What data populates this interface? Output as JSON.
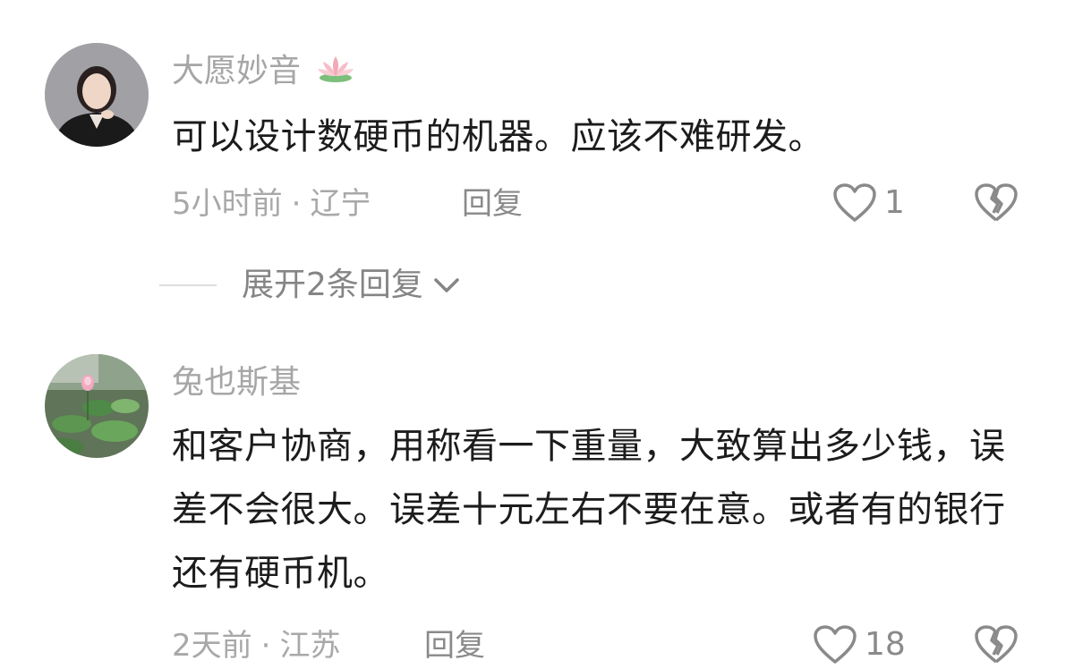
{
  "comments": [
    {
      "username": "大愿妙音",
      "username_badge": "lotus-emoji",
      "text": "可以设计数硬币的机器。应该不难研发。",
      "time": "5小时前",
      "separator": "·",
      "location": "辽宁",
      "reply_label": "回复",
      "likes": "1",
      "expand_replies_label": "展开2条回复"
    },
    {
      "username": "兔也斯基",
      "text": "和客户协商，用称看一下重量，大致算出多少钱，误差不会很大。误差十元左右不要在意。或者有的银行还有硬币机。",
      "time": "2天前",
      "separator": "·",
      "location": "江苏",
      "reply_label": "回复",
      "likes": "18"
    }
  ],
  "colors": {
    "username": "#a6a6a6",
    "body_text": "#1c1c1c",
    "meta": "#a8a8a8",
    "icon": "#8a8a8a"
  }
}
